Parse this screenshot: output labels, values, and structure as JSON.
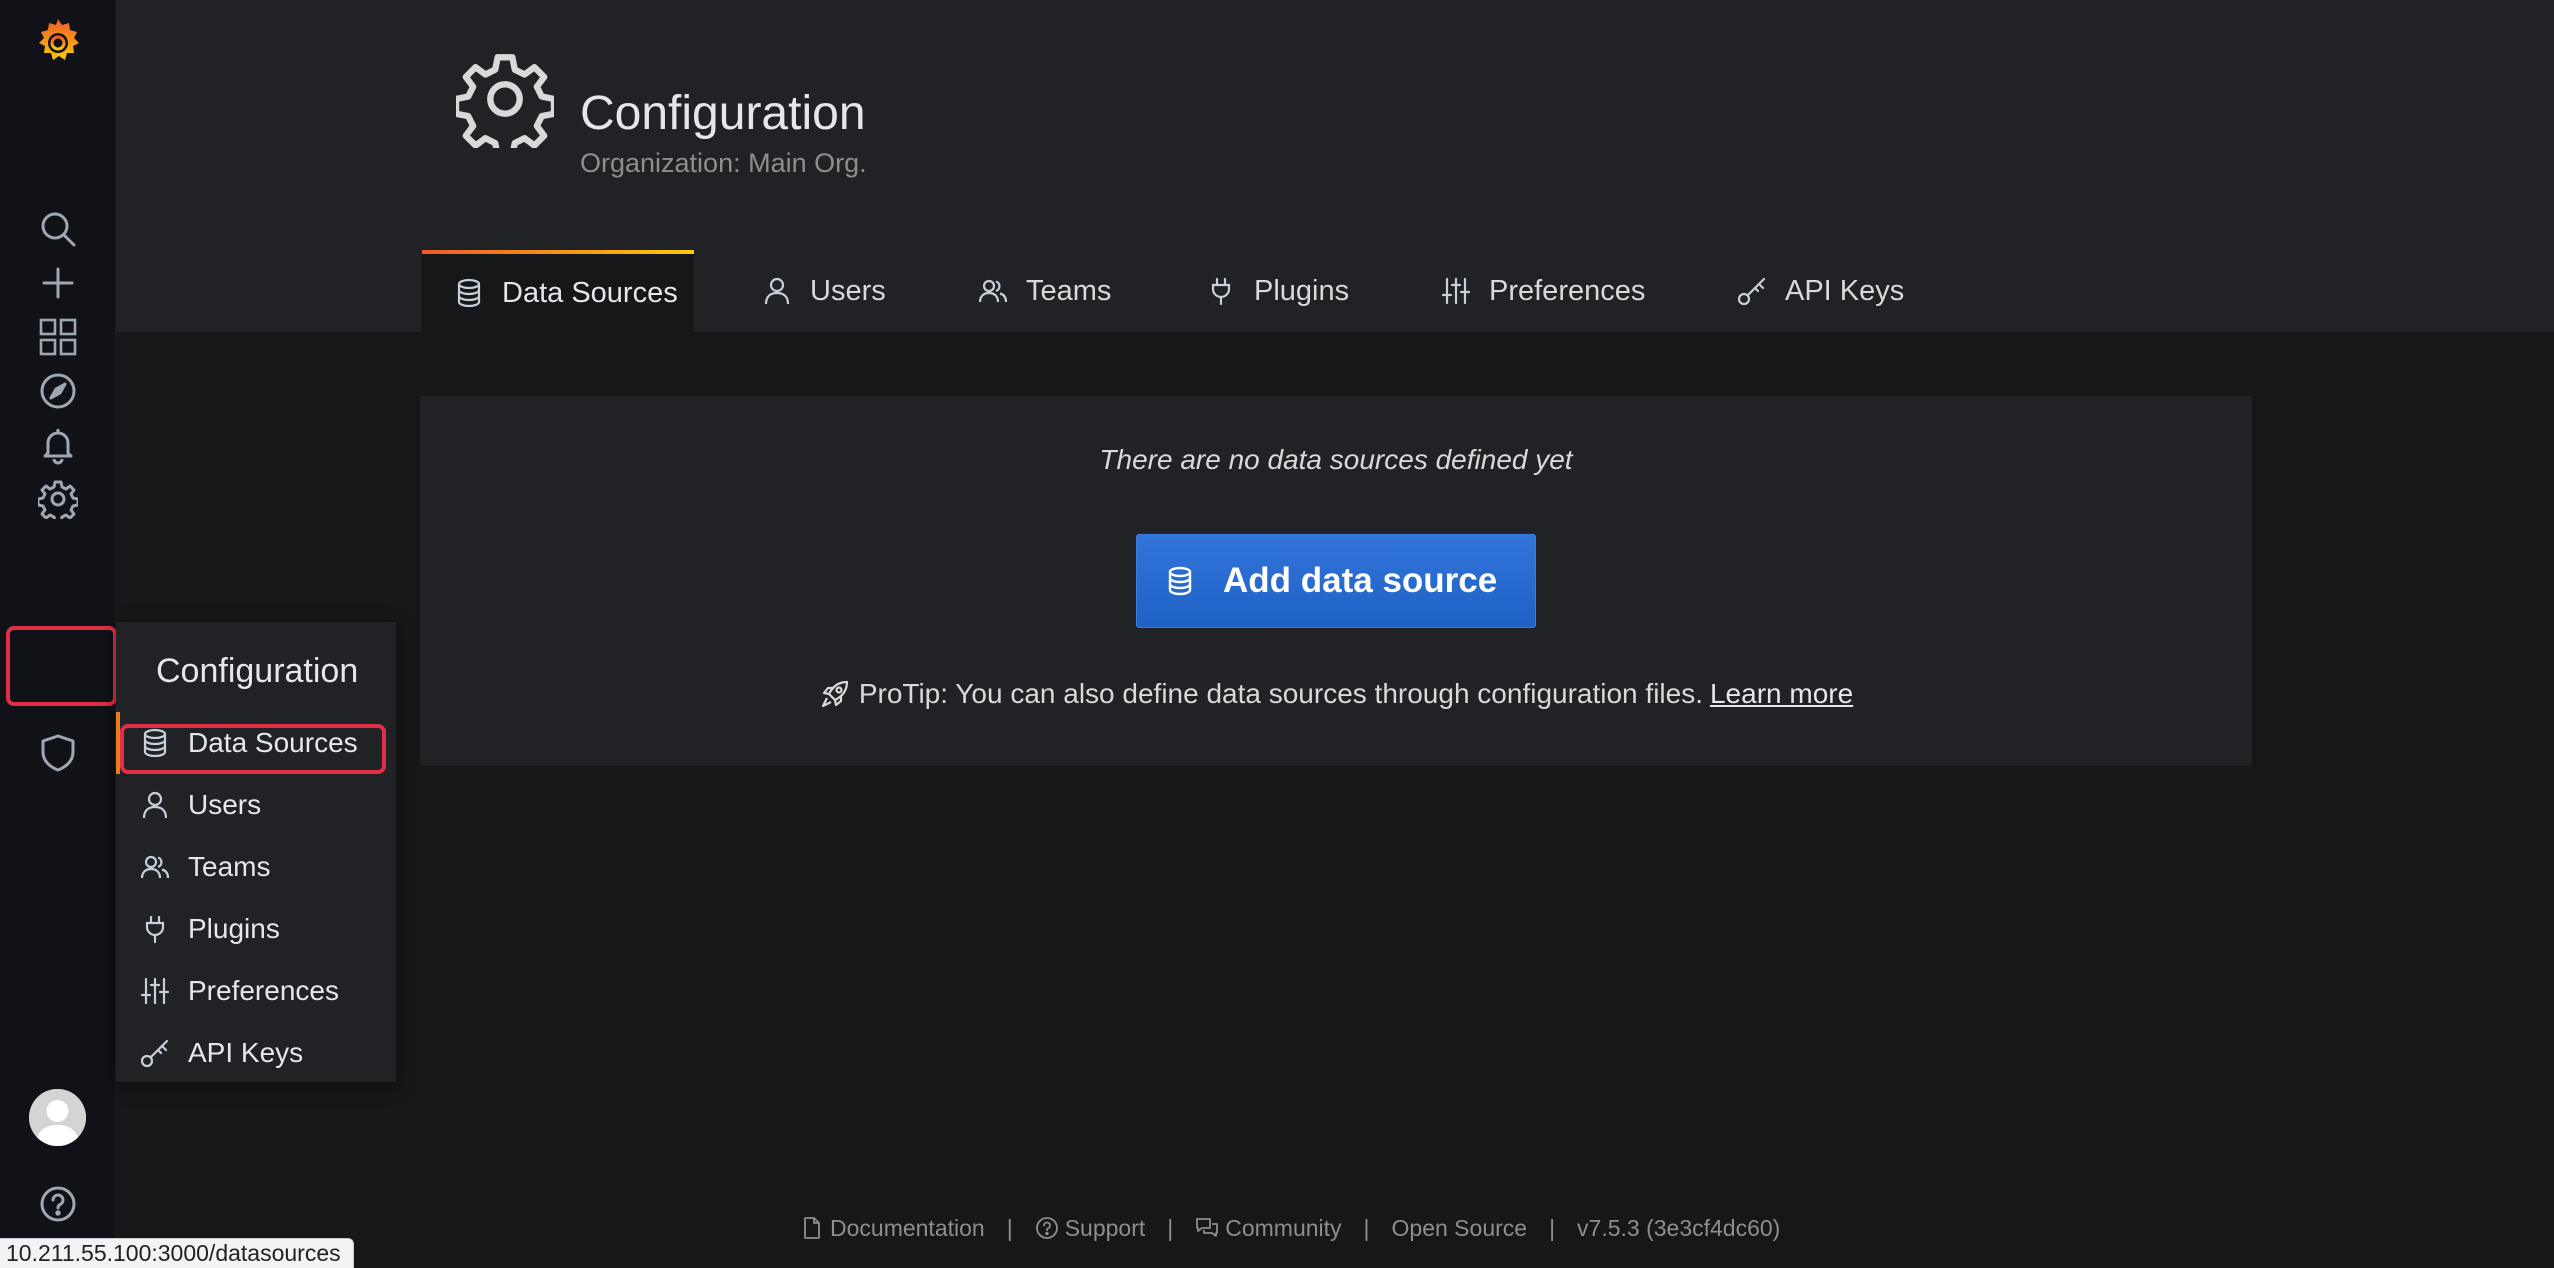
{
  "sidebar": {
    "icons": [
      "grafana-logo-icon",
      "search-icon",
      "plus-icon",
      "dashboards-icon",
      "explore-icon",
      "alerting-icon",
      "configuration-icon",
      "server-admin-icon",
      "user-avatar",
      "help-icon"
    ]
  },
  "flyout": {
    "title": "Configuration",
    "items": [
      {
        "label": "Data Sources",
        "icon": "database-icon",
        "active": true
      },
      {
        "label": "Users",
        "icon": "user-icon"
      },
      {
        "label": "Teams",
        "icon": "users-icon"
      },
      {
        "label": "Plugins",
        "icon": "plug-icon"
      },
      {
        "label": "Preferences",
        "icon": "sliders-icon"
      },
      {
        "label": "API Keys",
        "icon": "key-icon"
      }
    ]
  },
  "header": {
    "title": "Configuration",
    "subtitle": "Organization: Main Org.",
    "tabs": [
      {
        "label": "Data Sources",
        "icon": "database-icon",
        "active": true
      },
      {
        "label": "Users",
        "icon": "user-icon"
      },
      {
        "label": "Teams",
        "icon": "users-icon"
      },
      {
        "label": "Plugins",
        "icon": "plug-icon"
      },
      {
        "label": "Preferences",
        "icon": "sliders-icon"
      },
      {
        "label": "API Keys",
        "icon": "key-icon"
      }
    ]
  },
  "empty_state": {
    "message": "There are no data sources defined yet",
    "button_label": "Add data source",
    "protip": "ProTip: You can also define data sources through configuration files.",
    "learn_more": "Learn more"
  },
  "footer": {
    "links": [
      "Documentation",
      "Support",
      "Community",
      "Open Source"
    ],
    "version": "v7.5.3 (3e3cf4dc60)"
  },
  "status_bar": {
    "url": "10.211.55.100:3000/datasources"
  },
  "colors": {
    "accent_blue": "#3274d9",
    "highlight_red": "#e02f44",
    "tab_gradient_start": "#f05a28",
    "tab_gradient_end": "#fbca0a"
  }
}
